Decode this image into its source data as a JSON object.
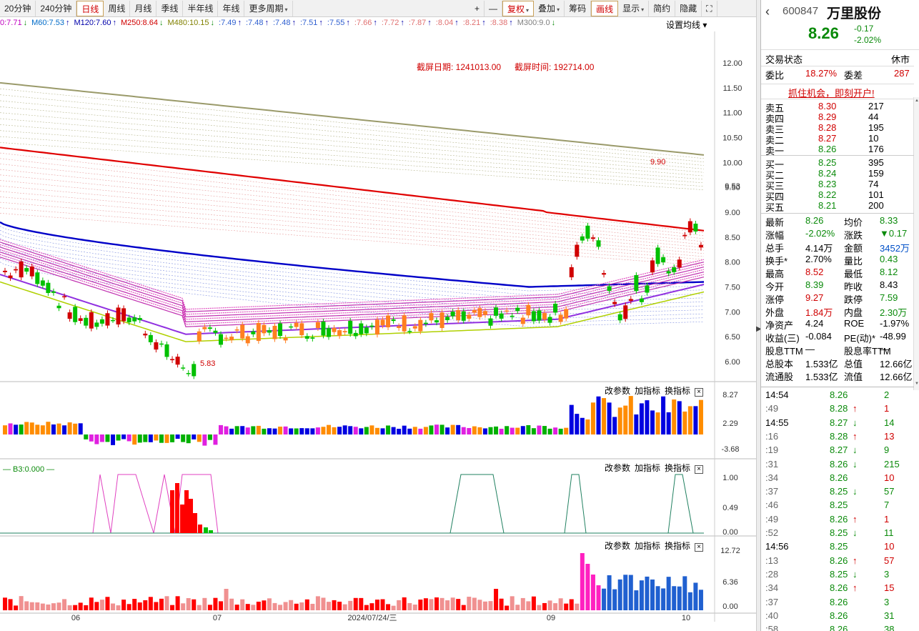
{
  "toolbar": {
    "left_items": [
      "20分钟",
      "240分钟",
      "日线",
      "周线",
      "月线",
      "季线",
      "半年线",
      "年线",
      "更多周期"
    ],
    "active": "日线",
    "right_items": [
      "+",
      "—",
      "复权",
      "叠加",
      "筹码",
      "画线",
      "显示",
      "简约",
      "隐藏"
    ]
  },
  "ma_legend": [
    {
      "text": "0:7.71",
      "color": "#c000c0",
      "dir": "↓"
    },
    {
      "text": "M60:7.53",
      "color": "#006bc8",
      "dir": "↑"
    },
    {
      "text": "M120:7.60",
      "color": "#0000aa",
      "dir": "↑"
    },
    {
      "text": "M250:8.64",
      "color": "#d00000",
      "dir": "↓"
    },
    {
      "text": "M480:10.15",
      "color": "#808000",
      "dir": "↓"
    },
    {
      "text": ":7.49",
      "color": "#3060d0",
      "dir": "↑"
    },
    {
      "text": ":7.48",
      "color": "#3060d0",
      "dir": "↑"
    },
    {
      "text": ":7.48",
      "color": "#3060d0",
      "dir": "↑"
    },
    {
      "text": ":7.51",
      "color": "#3060d0",
      "dir": "↑"
    },
    {
      "text": ":7.55",
      "color": "#3060d0",
      "dir": "↑"
    },
    {
      "text": ":7.66",
      "color": "#e07070",
      "dir": "↑"
    },
    {
      "text": ":7.72",
      "color": "#e07070",
      "dir": "↑"
    },
    {
      "text": ":7.87",
      "color": "#e07070",
      "dir": "↑"
    },
    {
      "text": ":8.04",
      "color": "#e07070",
      "dir": "↑"
    },
    {
      "text": ":8.21",
      "color": "#e07070",
      "dir": "↑"
    },
    {
      "text": ":8.38",
      "color": "#e07070",
      "dir": "↑"
    },
    {
      "text": "M300:9.0",
      "color": "#808080",
      "dir": "↓"
    }
  ],
  "ma_settings_label": "设置均线",
  "annotation": {
    "screenshot_date": "截屏日期: 1241013.00",
    "screenshot_time": "截屏时间: 192714.00",
    "high_mark": "9.90",
    "low_mark": "5.83"
  },
  "price_axis": [
    "12.00",
    "11.50",
    "11.00",
    "10.50",
    "10.00",
    "9.53",
    "9.50",
    "9.00",
    "8.50",
    "8.00",
    "7.50",
    "7.00",
    "6.50",
    "6.00"
  ],
  "panel_tools": {
    "params": "改参数",
    "add": "加指标",
    "switch": "换指标",
    "close": "×"
  },
  "indicator1_axis": [
    "8.27",
    "2.29",
    "-3.68"
  ],
  "indicator2": {
    "label": "B3:0.000",
    "axis": [
      "1.00",
      "0.49",
      "0.00"
    ]
  },
  "indicator3_axis": [
    "12.72",
    "6.36",
    "0.00"
  ],
  "time_axis": {
    "labels": [
      "06",
      "07",
      "2024/07/24/三",
      "09",
      "10"
    ]
  },
  "stock": {
    "code": "600847",
    "name": "万里股份",
    "price": "8.26",
    "change": "-0.17",
    "change_pct": "-2.02%"
  },
  "trade_status": {
    "label": "交易状态",
    "value": "休市"
  },
  "committee": {
    "ratio_label": "委比",
    "ratio": "18.27%",
    "diff_label": "委差",
    "diff": "287"
  },
  "promo": "抓住机会，即刻开户!",
  "asks": [
    {
      "label": "卖五",
      "price": "8.30",
      "vol": "217"
    },
    {
      "label": "卖四",
      "price": "8.29",
      "vol": "44"
    },
    {
      "label": "卖三",
      "price": "8.28",
      "vol": "195"
    },
    {
      "label": "卖二",
      "price": "8.27",
      "vol": "10"
    },
    {
      "label": "卖一",
      "price": "8.26",
      "vol": "176"
    }
  ],
  "bids": [
    {
      "label": "买一",
      "price": "8.25",
      "vol": "395"
    },
    {
      "label": "买二",
      "price": "8.24",
      "vol": "159"
    },
    {
      "label": "买三",
      "price": "8.23",
      "vol": "74"
    },
    {
      "label": "买四",
      "price": "8.22",
      "vol": "101"
    },
    {
      "label": "买五",
      "price": "8.21",
      "vol": "200"
    }
  ],
  "quote": [
    {
      "l1": "最新",
      "v1": "8.26",
      "c1": "g",
      "l2": "均价",
      "v2": "8.33",
      "c2": "g"
    },
    {
      "l1": "涨幅",
      "v1": "-2.02%",
      "c1": "g",
      "l2": "涨跌",
      "v2": "▼0.17",
      "c2": "g"
    },
    {
      "l1": "总手",
      "v1": "4.14万",
      "c1": "k",
      "l2": "金额",
      "v2": "3452万",
      "c2": "b"
    },
    {
      "l1": "换手*",
      "v1": "2.70%",
      "c1": "k",
      "l2": "量比",
      "v2": "0.43",
      "c2": "g"
    },
    {
      "l1": "最高",
      "v1": "8.52",
      "c1": "r",
      "l2": "最低",
      "v2": "8.12",
      "c2": "g"
    },
    {
      "l1": "今开",
      "v1": "8.39",
      "c1": "g",
      "l2": "昨收",
      "v2": "8.43",
      "c2": "k"
    },
    {
      "l1": "涨停",
      "v1": "9.27",
      "c1": "r",
      "l2": "跌停",
      "v2": "7.59",
      "c2": "g"
    },
    {
      "l1": "外盘",
      "v1": "1.84万",
      "c1": "r",
      "l2": "内盘",
      "v2": "2.30万",
      "c2": "g"
    },
    {
      "l1": "净资产",
      "v1": "4.24",
      "c1": "k",
      "l2": "ROE",
      "v2": "-1.97%",
      "c2": "k"
    },
    {
      "l1": "收益(三)",
      "v1": "-0.084",
      "c1": "k",
      "l2": "PE(动)*",
      "v2": "-48.99",
      "c2": "k"
    },
    {
      "l1": "股息TTM",
      "v1": "—",
      "c1": "k",
      "l2": "股息率TTM",
      "v2": "—",
      "c2": "k"
    },
    {
      "l1": "总股本",
      "v1": "1.533亿",
      "c1": "k",
      "l2": "总值",
      "v2": "12.66亿",
      "c2": "k"
    },
    {
      "l1": "流通股",
      "v1": "1.533亿",
      "c1": "k",
      "l2": "流值",
      "v2": "12.66亿",
      "c2": "k"
    }
  ],
  "ticks": [
    {
      "time": "14:54",
      "price": "8.26",
      "arrow": "",
      "vol": "2",
      "pc": "g",
      "vc": "g"
    },
    {
      "time": ":49",
      "price": "8.28",
      "arrow": "↑",
      "vol": "1",
      "pc": "g",
      "vc": "r"
    },
    {
      "time": "14:55",
      "price": "8.27",
      "arrow": "↓",
      "vol": "14",
      "pc": "g",
      "vc": "g"
    },
    {
      "time": ":16",
      "price": "8.28",
      "arrow": "↑",
      "vol": "13",
      "pc": "g",
      "vc": "r"
    },
    {
      "time": ":19",
      "price": "8.27",
      "arrow": "↓",
      "vol": "9",
      "pc": "g",
      "vc": "g"
    },
    {
      "time": ":31",
      "price": "8.26",
      "arrow": "↓",
      "vol": "215",
      "pc": "g",
      "vc": "g"
    },
    {
      "time": ":34",
      "price": "8.26",
      "arrow": "",
      "vol": "10",
      "pc": "g",
      "vc": "r"
    },
    {
      "time": ":37",
      "price": "8.25",
      "arrow": "↓",
      "vol": "57",
      "pc": "g",
      "vc": "g"
    },
    {
      "time": ":46",
      "price": "8.25",
      "arrow": "",
      "vol": "7",
      "pc": "g",
      "vc": "g"
    },
    {
      "time": ":49",
      "price": "8.26",
      "arrow": "↑",
      "vol": "1",
      "pc": "g",
      "vc": "r"
    },
    {
      "time": ":52",
      "price": "8.25",
      "arrow": "↓",
      "vol": "11",
      "pc": "g",
      "vc": "g"
    },
    {
      "time": "14:56",
      "price": "8.25",
      "arrow": "",
      "vol": "10",
      "pc": "g",
      "vc": "r"
    },
    {
      "time": ":13",
      "price": "8.26",
      "arrow": "↑",
      "vol": "57",
      "pc": "g",
      "vc": "r"
    },
    {
      "time": ":28",
      "price": "8.25",
      "arrow": "↓",
      "vol": "3",
      "pc": "g",
      "vc": "g"
    },
    {
      "time": ":34",
      "price": "8.26",
      "arrow": "↑",
      "vol": "15",
      "pc": "g",
      "vc": "r"
    },
    {
      "time": ":37",
      "price": "8.26",
      "arrow": "",
      "vol": "3",
      "pc": "g",
      "vc": "g"
    },
    {
      "time": ":40",
      "price": "8.26",
      "arrow": "",
      "vol": "31",
      "pc": "g",
      "vc": "g"
    },
    {
      "time": ":58",
      "price": "8.26",
      "arrow": "",
      "vol": "38",
      "pc": "g",
      "vc": "g"
    }
  ],
  "colors": {
    "up": "#d00000",
    "down": "#0a8a0a",
    "accent": "#d00000"
  }
}
